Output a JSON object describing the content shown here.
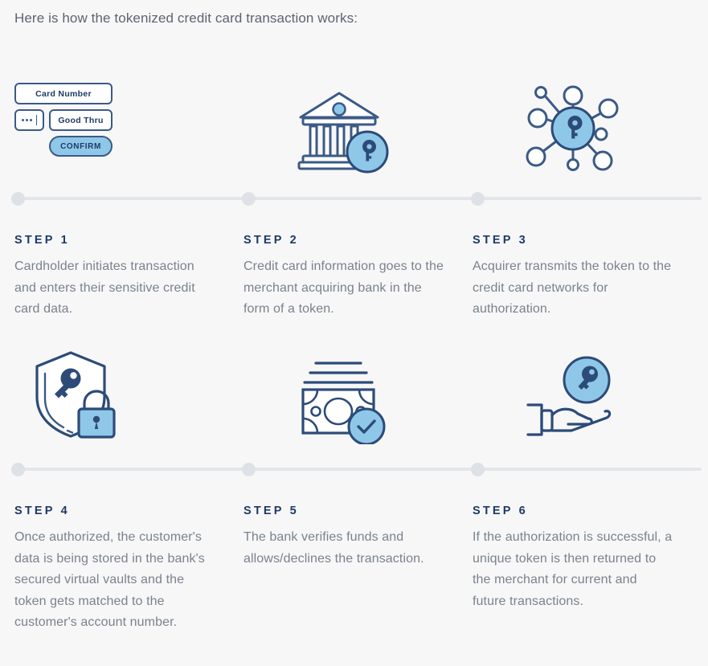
{
  "intro": {
    "heading": "Here is how the tokenized credit card transaction works:"
  },
  "colors": {
    "background": "#f7f7f8",
    "heading_text": "#5c6470",
    "step_label": "#1e3a63",
    "body_text": "#7a828c",
    "icon_stroke": "#3b5a86",
    "icon_accent": "#8fc7e8",
    "timeline_line": "#e3e6e9",
    "timeline_dot": "#dee2e6"
  },
  "card_form": {
    "card_number_label": "Card Number",
    "cvv_value": "•••",
    "good_thru_label": "Good Thru",
    "confirm_label": "CONFIRM"
  },
  "steps": [
    {
      "label": "STEP 1",
      "description": "Cardholder initiates transaction and enters their sensitive credit card data.",
      "icon": "credit-card-form-icon"
    },
    {
      "label": "STEP 2",
      "description": "Credit card information goes to the merchant acquiring bank in the form of a token.",
      "icon": "bank-with-key-icon"
    },
    {
      "label": "STEP 3",
      "description": "Acquirer transmits the token to the credit card networks for authorization.",
      "icon": "network-with-key-icon"
    },
    {
      "label": "STEP 4",
      "description": "Once authorized, the customer's data is being stored in the bank's secured virtual vaults and the token gets matched to the customer's account number.",
      "icon": "shield-key-lock-icon"
    },
    {
      "label": "STEP 5",
      "description": "The bank verifies funds and allows/declines the transaction.",
      "icon": "banknote-check-icon"
    },
    {
      "label": "STEP 6",
      "description": "If the authorization is successful, a unique token is then returned to the merchant for current and future transactions.",
      "icon": "hand-holding-key-icon"
    }
  ]
}
